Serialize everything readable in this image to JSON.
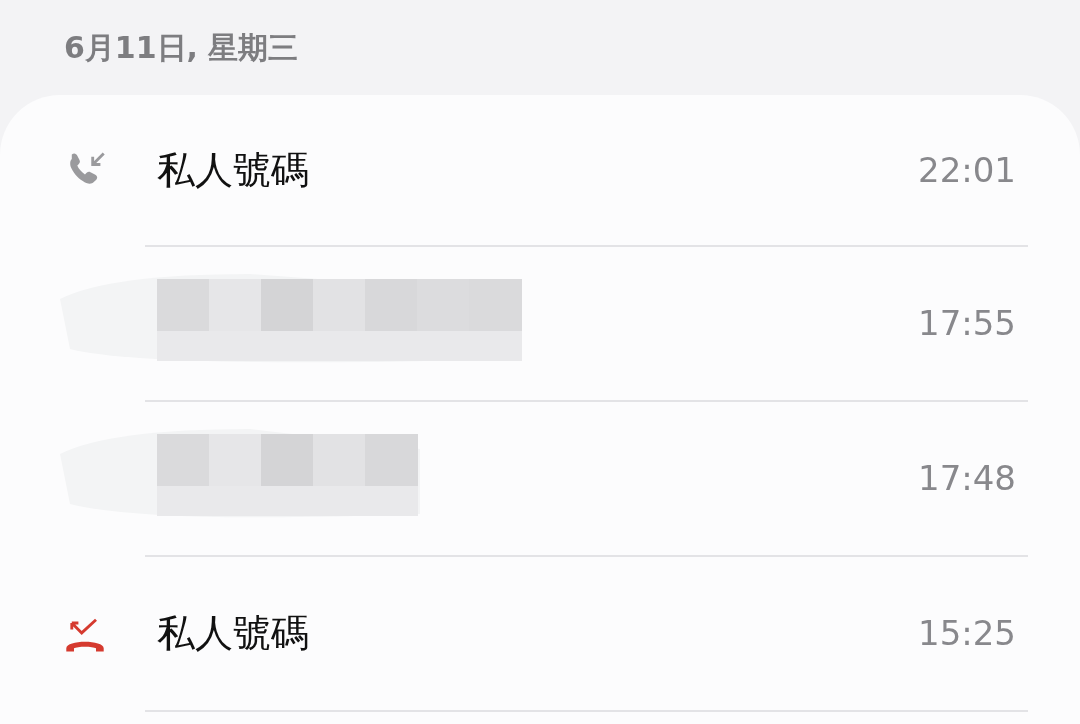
{
  "date_header": "6月11日, 星期三",
  "calls": [
    {
      "kind": "incoming",
      "name": "私人號碼",
      "time": "22:01"
    },
    {
      "kind": "redacted",
      "time": "17:55"
    },
    {
      "kind": "redacted",
      "time": "17:48"
    },
    {
      "kind": "missed",
      "name": "私人號碼",
      "time": "15:25"
    }
  ]
}
